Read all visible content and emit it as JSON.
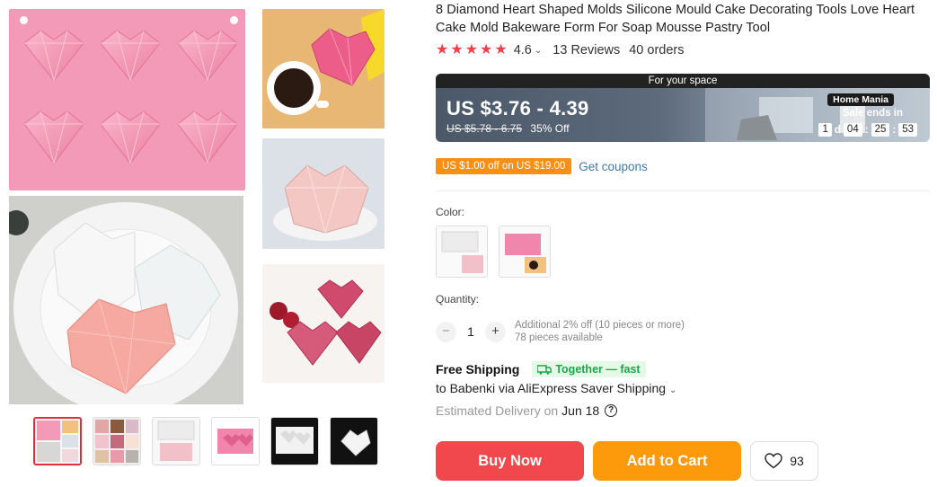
{
  "product": {
    "title": "8 Diamond Heart Shaped Molds Silicone Mould Cake Decorating Tools Love Heart Cake Mold Bakeware Form For Soap Mousse Pastry Tool",
    "rating": "4.6",
    "reviews": "13 Reviews",
    "orders": "40 orders",
    "stars_filled": 5
  },
  "banner": {
    "top_label": "For your space",
    "price": "US $3.76 - 4.39",
    "old_price": "US $5.78 - 6.75",
    "discount": "35% Off",
    "store": "Home Mania",
    "sale_ends": "Sale ends in",
    "countdown": {
      "days": "1",
      "d": "d",
      "hours": "04",
      "minutes": "25",
      "seconds": "53"
    }
  },
  "coupon": {
    "tag": "US $1.00 off on US $19.00",
    "link": "Get coupons"
  },
  "color": {
    "label": "Color:"
  },
  "quantity": {
    "label": "Quantity:",
    "minus": "−",
    "value": "1",
    "plus": "+",
    "note1": "Additional 2% off (10 pieces or more)",
    "note2": "78 pieces available"
  },
  "shipping": {
    "free": "Free Shipping",
    "together": "Together — fast",
    "to": "to Babenki via AliExpress Saver Shipping",
    "est_label": "Estimated Delivery on",
    "est_date": "Jun 18",
    "help": "?"
  },
  "actions": {
    "buy": "Buy Now",
    "cart": "Add to Cart",
    "wish_count": "93"
  },
  "colors": {
    "accent_red": "#f0484c",
    "accent_orange": "#fd9a0b",
    "link_blue": "#4178ad",
    "green": "#1ea64a"
  }
}
